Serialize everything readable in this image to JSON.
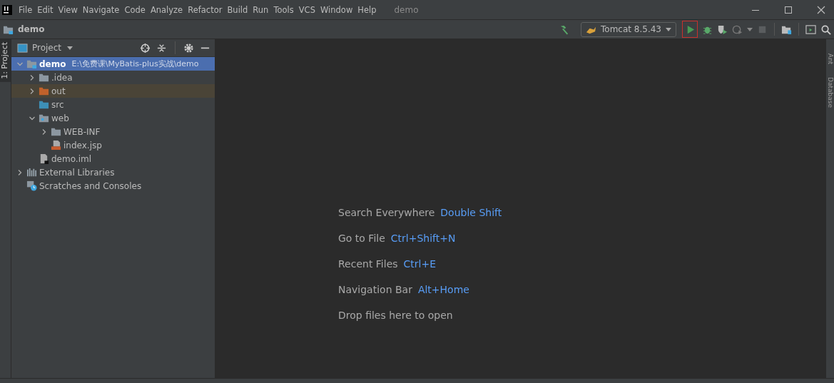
{
  "menu": [
    "File",
    "Edit",
    "View",
    "Navigate",
    "Code",
    "Analyze",
    "Refactor",
    "Build",
    "Run",
    "Tools",
    "VCS",
    "Window",
    "Help"
  ],
  "window": {
    "title": "demo"
  },
  "navbar": {
    "project": "demo"
  },
  "toolbar": {
    "run_config": "Tomcat 8.5.43"
  },
  "left_strip": {
    "tab": "1: Project"
  },
  "right_strip": {
    "tabs": [
      "Ant",
      "Database"
    ]
  },
  "project_panel": {
    "title": "Project",
    "tree": [
      {
        "name": "demo",
        "path": "E:\\免费课\\MyBatis-plus实战\\demo",
        "kind": "module",
        "expanded": true,
        "selected": true,
        "children": [
          {
            "name": ".idea",
            "kind": "folder",
            "expanded": false,
            "selected": false
          },
          {
            "name": "out",
            "kind": "excluded",
            "expanded": false,
            "selected": false
          },
          {
            "name": "src",
            "kind": "source",
            "selected": false
          },
          {
            "name": "web",
            "kind": "web",
            "expanded": true,
            "selected": false,
            "children": [
              {
                "name": "WEB-INF",
                "kind": "folder",
                "expanded": false,
                "selected": false
              },
              {
                "name": "index.jsp",
                "kind": "jsp",
                "selected": false
              }
            ]
          },
          {
            "name": "demo.iml",
            "kind": "iml",
            "selected": false
          }
        ]
      },
      {
        "name": "External Libraries",
        "kind": "libraries",
        "expanded": false,
        "selected": false
      },
      {
        "name": "Scratches and Consoles",
        "kind": "scratches",
        "selected": false
      }
    ]
  },
  "editor_hints": [
    {
      "label": "Search Everywhere",
      "shortcut": "Double Shift"
    },
    {
      "label": "Go to File",
      "shortcut": "Ctrl+Shift+N"
    },
    {
      "label": "Recent Files",
      "shortcut": "Ctrl+E"
    },
    {
      "label": "Navigation Bar",
      "shortcut": "Alt+Home"
    },
    {
      "label": "Drop files here to open"
    }
  ]
}
